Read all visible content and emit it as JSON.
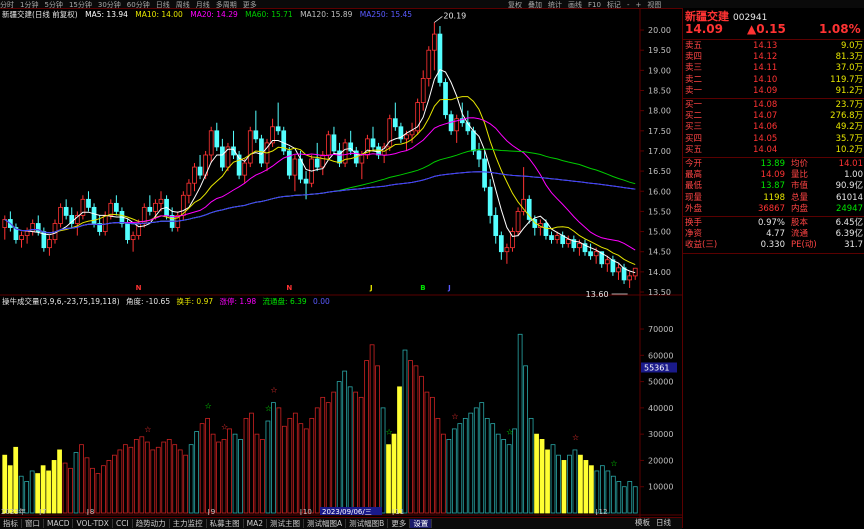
{
  "toolbar": {
    "periods": [
      "分时",
      "1分钟",
      "5分钟",
      "15分钟",
      "30分钟",
      "60分钟",
      "日线",
      "周线",
      "月线",
      "多周期",
      "更多"
    ],
    "right_items": [
      "复权",
      "叠加",
      "统计",
      "画线",
      "F10",
      "标记",
      "-",
      "+",
      "视图"
    ]
  },
  "main_legend": {
    "title": "新疆交建(日线 前复权)",
    "ma5": "MA5: 13.94",
    "ma10": "MA10: 14.00",
    "ma20": "MA20: 14.29",
    "ma60": "MA60: 15.71",
    "ma120": "MA120: 15.89",
    "ma250": "MA250: 15.45"
  },
  "vol_legend": {
    "title": "操牛成交量(3,9,6,-23,75,19,118)",
    "angle": "角度: -10.65",
    "turnover": "换手: 0.97",
    "rise": "涨停: 1.98",
    "flow": "流通盘: 6.39",
    "extra": "0.00"
  },
  "colors": {
    "up": "#ff3333",
    "down": "#54ffff",
    "ma5": "#ffffff",
    "ma10": "#e6e600",
    "ma20": "#ff00ff",
    "ma60": "#00cc00",
    "ma120": "#c0c0c0",
    "ma250": "#3a3aff",
    "grid": "#5a0000",
    "vol_yellow": "#ffff33",
    "vol_red": "#cc2222",
    "vol_cyan": "#2aa8a8"
  },
  "chart_data": [
    {
      "type": "candlestick",
      "ylim": [
        13.5,
        20.2
      ],
      "ticks": [
        "20.00",
        "19.50",
        "19.00",
        "18.50",
        "18.00",
        "17.50",
        "17.00",
        "16.50",
        "16.00",
        "15.50",
        "15.00",
        "14.50",
        "14.00",
        "13.50"
      ],
      "tick_values": [
        20.0,
        19.5,
        19.0,
        18.5,
        18.0,
        17.5,
        17.0,
        16.5,
        16.0,
        15.5,
        15.0,
        14.5,
        14.0,
        13.5
      ],
      "annotations": {
        "high": "20.19",
        "low": "13.60"
      },
      "x_markers": [
        "8",
        "9",
        "10",
        "11",
        "12"
      ],
      "events": [
        "N",
        "N",
        "J",
        "B",
        "J"
      ],
      "candles": [
        [
          15.1,
          15.4,
          14.8,
          15.3
        ],
        [
          15.3,
          15.5,
          15.0,
          15.1
        ],
        [
          15.1,
          15.2,
          14.7,
          14.8
        ],
        [
          14.8,
          15.0,
          14.6,
          14.9
        ],
        [
          14.9,
          15.1,
          14.7,
          15.0
        ],
        [
          15.0,
          15.3,
          14.9,
          15.2
        ],
        [
          15.2,
          15.4,
          14.9,
          15.0
        ],
        [
          15.0,
          15.1,
          14.5,
          14.6
        ],
        [
          14.6,
          14.9,
          14.4,
          14.8
        ],
        [
          14.8,
          15.3,
          14.7,
          15.2
        ],
        [
          15.2,
          15.7,
          15.1,
          15.6
        ],
        [
          15.6,
          15.8,
          15.3,
          15.4
        ],
        [
          15.4,
          15.6,
          15.1,
          15.2
        ],
        [
          15.2,
          15.5,
          14.9,
          15.4
        ],
        [
          15.4,
          15.9,
          15.3,
          15.8
        ],
        [
          15.8,
          16.0,
          15.5,
          15.6
        ],
        [
          15.6,
          15.7,
          15.1,
          15.2
        ],
        [
          15.2,
          15.4,
          14.9,
          15.0
        ],
        [
          15.0,
          15.5,
          14.9,
          15.4
        ],
        [
          15.4,
          15.8,
          15.3,
          15.7
        ],
        [
          15.7,
          15.9,
          15.4,
          15.5
        ],
        [
          15.5,
          15.6,
          15.1,
          15.2
        ],
        [
          15.2,
          15.3,
          14.7,
          14.8
        ],
        [
          14.8,
          15.0,
          14.5,
          14.9
        ],
        [
          14.9,
          15.3,
          14.8,
          15.2
        ],
        [
          15.2,
          15.7,
          15.1,
          15.6
        ],
        [
          15.6,
          15.9,
          15.4,
          15.5
        ],
        [
          15.5,
          15.8,
          15.3,
          15.7
        ],
        [
          15.7,
          16.0,
          15.5,
          15.8
        ],
        [
          15.8,
          15.9,
          15.3,
          15.4
        ],
        [
          15.4,
          15.6,
          15.0,
          15.1
        ],
        [
          15.1,
          15.5,
          15.0,
          15.4
        ],
        [
          15.4,
          16.0,
          15.3,
          15.9
        ],
        [
          15.9,
          16.3,
          15.7,
          16.2
        ],
        [
          16.2,
          16.7,
          16.0,
          16.6
        ],
        [
          16.6,
          16.9,
          16.3,
          16.4
        ],
        [
          16.4,
          17.0,
          16.3,
          16.9
        ],
        [
          16.9,
          17.6,
          16.7,
          17.5
        ],
        [
          17.5,
          17.7,
          17.0,
          17.1
        ],
        [
          17.1,
          17.3,
          16.5,
          16.6
        ],
        [
          16.6,
          17.2,
          16.5,
          17.1
        ],
        [
          17.1,
          17.5,
          16.8,
          16.9
        ],
        [
          16.9,
          17.0,
          16.3,
          16.4
        ],
        [
          16.4,
          16.8,
          16.2,
          16.7
        ],
        [
          16.7,
          17.6,
          16.6,
          17.5
        ],
        [
          17.5,
          18.0,
          17.2,
          17.3
        ],
        [
          17.3,
          17.4,
          16.6,
          16.7
        ],
        [
          16.7,
          17.3,
          16.5,
          17.2
        ],
        [
          17.2,
          17.8,
          17.1,
          17.6
        ],
        [
          17.6,
          18.2,
          17.4,
          17.5
        ],
        [
          17.5,
          17.6,
          16.9,
          17.0
        ],
        [
          17.0,
          17.1,
          16.3,
          16.4
        ],
        [
          16.4,
          16.9,
          16.0,
          16.8
        ],
        [
          16.8,
          17.0,
          16.2,
          16.3
        ],
        [
          16.3,
          16.5,
          15.8,
          16.2
        ],
        [
          16.2,
          16.9,
          16.1,
          16.8
        ],
        [
          16.8,
          17.2,
          16.5,
          16.6
        ],
        [
          16.6,
          17.0,
          16.4,
          16.9
        ],
        [
          16.9,
          17.5,
          16.8,
          17.4
        ],
        [
          17.4,
          17.6,
          16.9,
          17.0
        ],
        [
          17.0,
          17.2,
          16.6,
          16.7
        ],
        [
          16.7,
          17.3,
          16.6,
          17.2
        ],
        [
          17.2,
          17.5,
          16.9,
          17.0
        ],
        [
          17.0,
          17.1,
          16.6,
          16.7
        ],
        [
          16.7,
          17.0,
          16.3,
          16.9
        ],
        [
          16.9,
          17.4,
          16.8,
          17.3
        ],
        [
          17.3,
          17.6,
          17.0,
          17.1
        ],
        [
          17.1,
          17.2,
          16.8,
          16.9
        ],
        [
          16.9,
          17.2,
          16.7,
          17.1
        ],
        [
          17.1,
          17.9,
          17.0,
          17.8
        ],
        [
          17.8,
          18.2,
          17.5,
          17.6
        ],
        [
          17.6,
          17.7,
          17.2,
          17.3
        ],
        [
          17.3,
          17.5,
          17.0,
          17.4
        ],
        [
          17.4,
          17.7,
          17.2,
          17.5
        ],
        [
          17.5,
          18.3,
          17.4,
          18.2
        ],
        [
          18.2,
          19.0,
          18.0,
          18.8
        ],
        [
          18.8,
          19.6,
          18.6,
          19.5
        ],
        [
          19.5,
          20.19,
          19.0,
          19.9
        ],
        [
          19.9,
          20.1,
          18.6,
          18.7
        ],
        [
          18.7,
          18.8,
          17.8,
          17.9
        ],
        [
          17.9,
          18.0,
          17.4,
          17.5
        ],
        [
          17.5,
          17.9,
          17.2,
          17.8
        ],
        [
          17.8,
          18.2,
          17.6,
          17.7
        ],
        [
          17.7,
          18.0,
          17.4,
          17.5
        ],
        [
          17.5,
          17.6,
          16.9,
          17.0
        ],
        [
          17.0,
          17.2,
          16.6,
          16.8
        ],
        [
          16.8,
          17.0,
          16.0,
          16.1
        ],
        [
          16.1,
          16.3,
          15.2,
          15.4
        ],
        [
          15.4,
          15.6,
          14.7,
          14.9
        ],
        [
          14.9,
          15.0,
          14.3,
          14.5
        ],
        [
          14.5,
          14.7,
          14.2,
          14.6
        ],
        [
          14.6,
          15.1,
          14.5,
          15.0
        ],
        [
          15.0,
          15.6,
          14.9,
          15.5
        ],
        [
          15.5,
          16.6,
          15.4,
          15.8
        ],
        [
          15.8,
          15.9,
          15.2,
          15.3
        ],
        [
          15.3,
          15.4,
          14.9,
          15.1
        ],
        [
          15.1,
          15.3,
          14.9,
          15.2
        ],
        [
          15.2,
          15.3,
          14.8,
          14.9
        ],
        [
          14.9,
          15.0,
          14.7,
          14.8
        ],
        [
          14.8,
          15.0,
          14.7,
          14.9
        ],
        [
          14.9,
          15.0,
          14.6,
          14.7
        ],
        [
          14.7,
          14.9,
          14.6,
          14.8
        ],
        [
          14.8,
          14.9,
          14.5,
          14.6
        ],
        [
          14.6,
          14.8,
          14.4,
          14.7
        ],
        [
          14.7,
          14.8,
          14.4,
          14.5
        ],
        [
          14.5,
          14.7,
          14.3,
          14.4
        ],
        [
          14.4,
          14.6,
          14.2,
          14.5
        ],
        [
          14.5,
          14.5,
          14.1,
          14.2
        ],
        [
          14.2,
          14.4,
          14.0,
          14.3
        ],
        [
          14.3,
          14.4,
          13.9,
          14.0
        ],
        [
          14.0,
          14.2,
          13.8,
          14.1
        ],
        [
          14.1,
          14.2,
          13.7,
          13.8
        ],
        [
          13.8,
          14.0,
          13.6,
          13.9
        ],
        [
          13.9,
          14.1,
          13.8,
          14.09
        ]
      ]
    },
    {
      "type": "bar",
      "name": "volume",
      "ylim": [
        0,
        78000
      ],
      "ticks": [
        "70000",
        "60000",
        "50000",
        "40000",
        "30000",
        "20000",
        "10000"
      ],
      "tick_values": [
        70000,
        60000,
        50000,
        40000,
        30000,
        20000,
        10000
      ],
      "highlight_label": "55361",
      "values": [
        22000,
        18000,
        25000,
        14000,
        12000,
        16000,
        15000,
        18000,
        16000,
        20000,
        24000,
        19000,
        17000,
        23000,
        26000,
        21000,
        17000,
        15000,
        18000,
        20000,
        22000,
        24000,
        26000,
        25000,
        28000,
        29000,
        27000,
        24000,
        25000,
        27000,
        28000,
        26000,
        24000,
        22000,
        26000,
        31000,
        34000,
        36000,
        30000,
        27000,
        28000,
        32000,
        30000,
        28000,
        36000,
        38000,
        30000,
        28000,
        35000,
        42000,
        40000,
        33000,
        36000,
        38000,
        34000,
        32000,
        36000,
        40000,
        44000,
        42000,
        46000,
        50000,
        54000,
        48000,
        46000,
        44000,
        58000,
        64000,
        56000,
        40000,
        26000,
        30000,
        48000,
        62000,
        58000,
        56000,
        52000,
        46000,
        44000,
        36000,
        30000,
        28000,
        32000,
        34000,
        36000,
        38000,
        40000,
        42000,
        36000,
        34000,
        30000,
        28000,
        26000,
        32000,
        68000,
        56000,
        36000,
        30000,
        28000,
        24000,
        26000,
        22000,
        20000,
        22000,
        24000,
        22000,
        20000,
        18000,
        16000,
        18000,
        16000,
        14000,
        12000,
        10000,
        12000,
        10000
      ],
      "colors": [
        "y",
        "y",
        "y",
        "c",
        "c",
        "c",
        "y",
        "y",
        "y",
        "y",
        "y",
        "r",
        "r",
        "c",
        "r",
        "r",
        "r",
        "r",
        "r",
        "r",
        "r",
        "r",
        "r",
        "r",
        "r",
        "r",
        "r",
        "r",
        "r",
        "r",
        "r",
        "r",
        "r",
        "r",
        "c",
        "c",
        "r",
        "r",
        "r",
        "r",
        "r",
        "r",
        "c",
        "c",
        "r",
        "r",
        "r",
        "r",
        "c",
        "c",
        "r",
        "r",
        "r",
        "r",
        "r",
        "r",
        "r",
        "r",
        "r",
        "r",
        "r",
        "c",
        "c",
        "c",
        "r",
        "r",
        "r",
        "r",
        "r",
        "c",
        "y",
        "y",
        "y",
        "c",
        "r",
        "r",
        "r",
        "r",
        "r",
        "r",
        "r",
        "c",
        "c",
        "c",
        "c",
        "c",
        "c",
        "c",
        "c",
        "c",
        "c",
        "c",
        "c",
        "c",
        "c",
        "c",
        "c",
        "y",
        "y",
        "y",
        "c",
        "c",
        "y",
        "c",
        "c",
        "y",
        "y",
        "y",
        "c",
        "c",
        "c",
        "c",
        "c",
        "c",
        "c",
        "c"
      ],
      "stars": [
        {
          "index": 31,
          "color": "r"
        },
        {
          "index": 45,
          "color": "g"
        },
        {
          "index": 48,
          "color": "r"
        },
        {
          "index": 58,
          "color": "g"
        },
        {
          "index": 59,
          "color": "r"
        },
        {
          "index": 84,
          "color": "g"
        },
        {
          "index": 99,
          "color": "r"
        },
        {
          "index": 111,
          "color": "g"
        },
        {
          "index": 126,
          "color": "r"
        },
        {
          "index": 134,
          "color": "g"
        }
      ]
    }
  ],
  "x_axis": {
    "start_label": "2023年",
    "month_labels": [
      "7",
      "8",
      "9",
      "10",
      "11",
      "12"
    ],
    "cursor_label": "2023/09/06/三"
  },
  "bottom_tabs": [
    "指标",
    "窗口",
    "MACD",
    "VOL-TDX",
    "CCI",
    "趋势动力",
    "主力监控",
    "私募主图",
    "MA2",
    "测试主图",
    "测试幅图A",
    "测试幅图B",
    "更多",
    "设置"
  ],
  "bottom_right": [
    "模板",
    "日线"
  ],
  "panel": {
    "name": "新疆交建",
    "code": "002941",
    "price": "14.09",
    "change": "▲0.15",
    "pct": "1.08%",
    "sell": [
      {
        "label": "卖五",
        "price": "14.13",
        "vol": "9.0万"
      },
      {
        "label": "卖四",
        "price": "14.12",
        "vol": "81.3万"
      },
      {
        "label": "卖三",
        "price": "14.11",
        "vol": "37.0万"
      },
      {
        "label": "卖二",
        "price": "14.10",
        "vol": "119.7万"
      },
      {
        "label": "卖一",
        "price": "14.09",
        "vol": "91.2万"
      }
    ],
    "buy": [
      {
        "label": "买一",
        "price": "14.08",
        "vol": "23.7万"
      },
      {
        "label": "买二",
        "price": "14.07",
        "vol": "276.8万"
      },
      {
        "label": "买三",
        "price": "14.06",
        "vol": "49.2万"
      },
      {
        "label": "买四",
        "price": "14.05",
        "vol": "35.7万"
      },
      {
        "label": "买五",
        "price": "14.04",
        "vol": "10.2万"
      }
    ],
    "stats": [
      {
        "l1": "今开",
        "v1": "13.89",
        "c1": "green",
        "l2": "均价",
        "v2": "14.01",
        "c2": "red"
      },
      {
        "l1": "最高",
        "v1": "14.09",
        "c1": "red",
        "l2": "量比",
        "v2": "1.00",
        "c2": "white"
      },
      {
        "l1": "最低",
        "v1": "13.87",
        "c1": "green",
        "l2": "市值",
        "v2": "90.9亿",
        "c2": "white"
      },
      {
        "l1": "现量",
        "v1": "1198",
        "c1": "yellow",
        "l2": "总量",
        "v2": "61014",
        "c2": "white"
      },
      {
        "l1": "外盘",
        "v1": "36867",
        "c1": "red",
        "l2": "内盘",
        "v2": "24947",
        "c2": "green"
      }
    ],
    "stats2": [
      {
        "l1": "换手",
        "v1": "0.97%",
        "c1": "white",
        "l2": "股本",
        "v2": "6.45亿",
        "c2": "white"
      },
      {
        "l1": "净资",
        "v1": "4.77",
        "c1": "white",
        "l2": "流通",
        "v2": "6.39亿",
        "c2": "white"
      },
      {
        "l1": "收益(三)",
        "v1": "0.330",
        "c1": "white",
        "l2": "PE(动)",
        "v2": "31.7",
        "c2": "white"
      }
    ]
  }
}
